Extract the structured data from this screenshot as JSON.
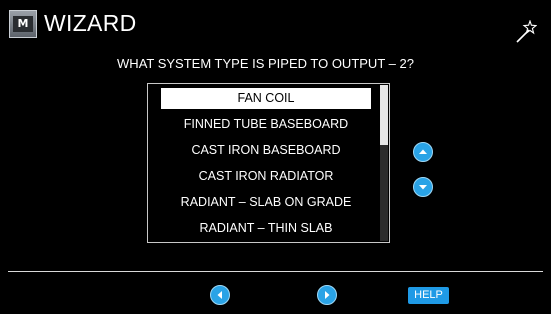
{
  "header": {
    "title": "WIZARD",
    "app_icon_label": "M",
    "wand_icon": "magic-wand-icon"
  },
  "question": "WHAT SYSTEM TYPE IS PIPED TO OUTPUT – 2?",
  "options": [
    {
      "label": "FAN COIL",
      "selected": true
    },
    {
      "label": "FINNED TUBE BASEBOARD",
      "selected": false
    },
    {
      "label": "CAST IRON BASEBOARD",
      "selected": false
    },
    {
      "label": "CAST IRON RADIATOR",
      "selected": false
    },
    {
      "label": "RADIANT – SLAB ON GRADE",
      "selected": false
    },
    {
      "label": "RADIANT – THIN SLAB",
      "selected": false
    }
  ],
  "nav": {
    "up_icon": "arrow-up-icon",
    "down_icon": "arrow-down-icon",
    "back_icon": "arrow-left-icon",
    "next_icon": "arrow-right-icon",
    "help_label": "HELP"
  },
  "colors": {
    "background": "#000000",
    "accent": "#2aa3e6",
    "selection": "#ffffff"
  }
}
